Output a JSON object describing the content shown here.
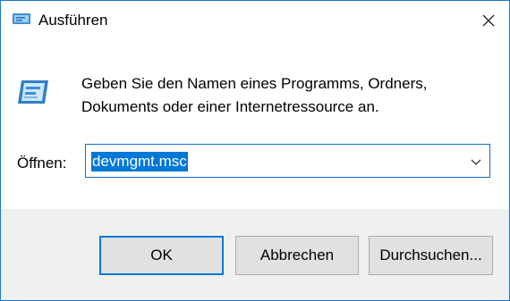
{
  "window": {
    "title": "Ausführen",
    "close_icon": "close-icon"
  },
  "dialog": {
    "description": "Geben Sie den Namen eines Programms, Ordners, Dokuments oder einer Internetressource an.",
    "open_label": "Öffnen:",
    "open_value": "devmgmt.msc"
  },
  "buttons": {
    "ok": "OK",
    "cancel": "Abbrechen",
    "browse": "Durchsuchen..."
  },
  "colors": {
    "accent": "#0078d7",
    "window_border": "#1778d2",
    "footer_bg": "#f0f0f0",
    "button_bg": "#e1e1e1"
  }
}
